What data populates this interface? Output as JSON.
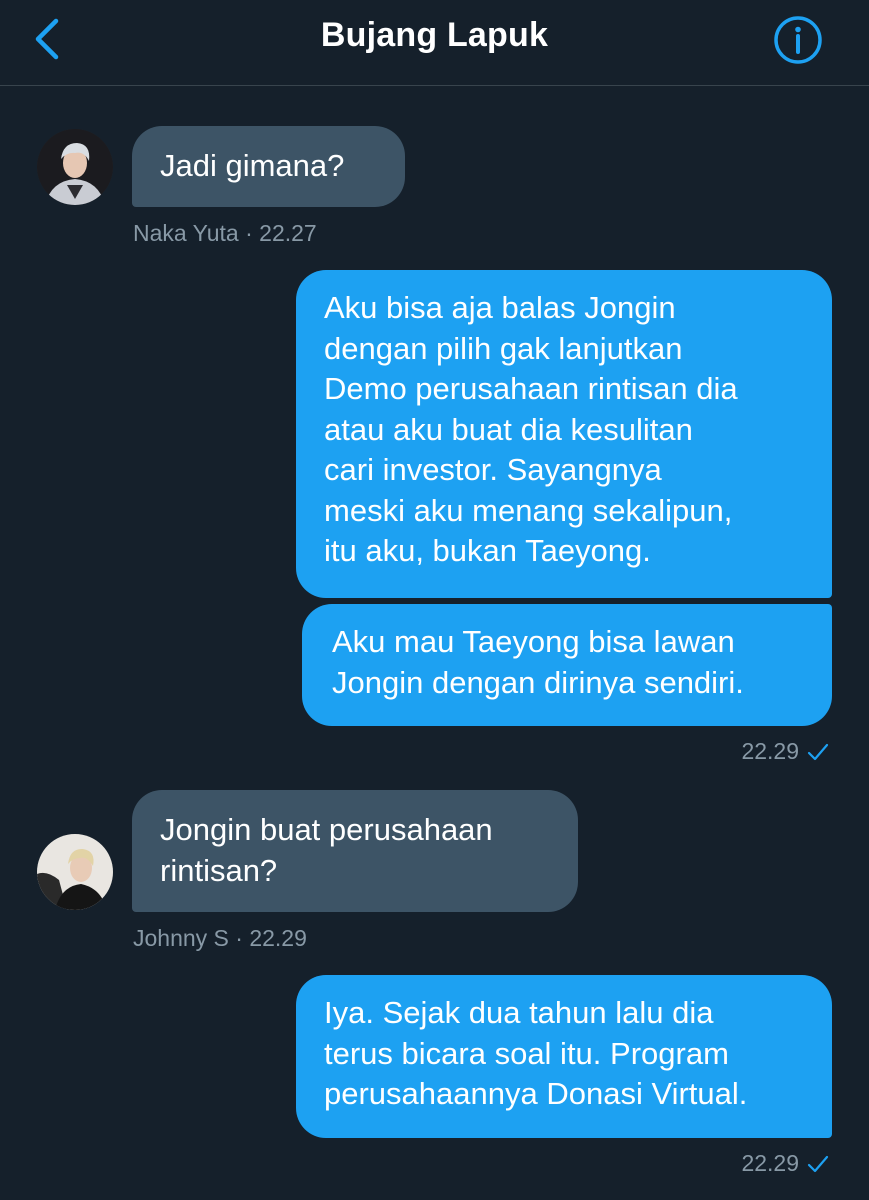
{
  "header": {
    "title": "Bujang Lapuk",
    "back_icon": "chevron-left-icon",
    "info_icon": "info-icon",
    "accent": "#1da1f2"
  },
  "colors": {
    "background": "#15202b",
    "incoming_bubble": "#3d5466",
    "outgoing_bubble": "#1da1f2",
    "meta_text": "#8899a6"
  },
  "messages": [
    {
      "direction": "in",
      "text": "Jadi gimana?",
      "meta": "Naka Yuta · 22.27"
    },
    {
      "direction": "out",
      "text": "Aku bisa aja balas Jongin\ndengan pilih gak lanjutkan\nDemo perusahaan rintisan dia\natau aku buat dia kesulitan\ncari investor. Sayangnya\nmeski aku menang sekalipun,\nitu aku, bukan Taeyong."
    },
    {
      "direction": "out",
      "text": "Aku mau Taeyong bisa lawan\nJongin dengan dirinya sendiri.",
      "meta": "22.29"
    },
    {
      "direction": "in",
      "text": "Jongin buat perusahaan\nrintisan?",
      "meta": "Johnny S · 22.29"
    },
    {
      "direction": "out",
      "text": "Iya. Sejak dua tahun lalu dia\nterus bicara soal itu. Program\nperusahaannya Donasi Virtual.",
      "meta": "22.29"
    }
  ]
}
